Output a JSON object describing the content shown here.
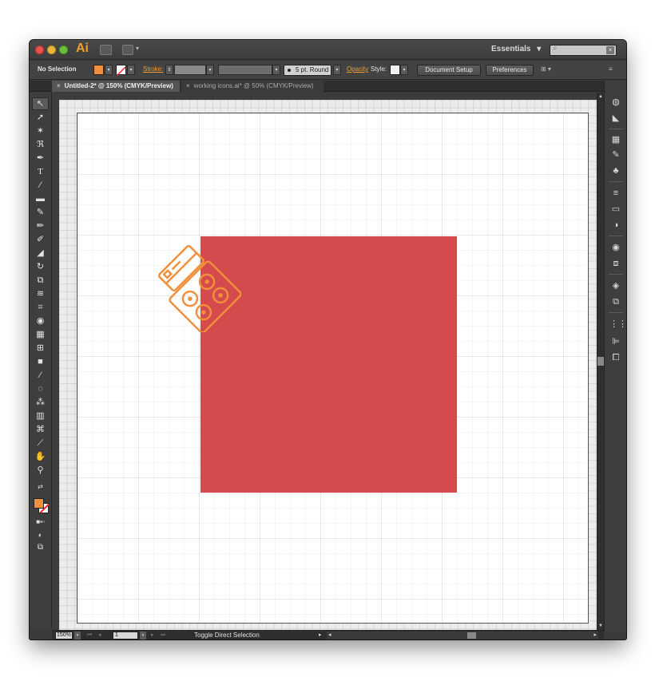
{
  "titlebar": {
    "app_logo": "Ai",
    "workspace": "Essentials",
    "workspace_caret": "▾"
  },
  "controlbar": {
    "selection": "No Selection",
    "fill_color": "#f0903c",
    "stroke_label": "Stroke:",
    "brush": "5 pt. Round",
    "opacity_label": "Opacity",
    "style_label": "Style:",
    "document_setup": "Document Setup",
    "preferences": "Preferences"
  },
  "tabs": [
    {
      "label": "Untitled-2* @ 150% (CMYK/Preview)",
      "active": true
    },
    {
      "label": "working icons.ai* @ 50% (CMYK/Preview)",
      "active": false
    }
  ],
  "canvas": {
    "rect_color": "#d54a4d",
    "icon_color": "#f0903c"
  },
  "statusbar": {
    "zoom": "150%",
    "page": "1",
    "status": "Toggle Direct Selection"
  }
}
